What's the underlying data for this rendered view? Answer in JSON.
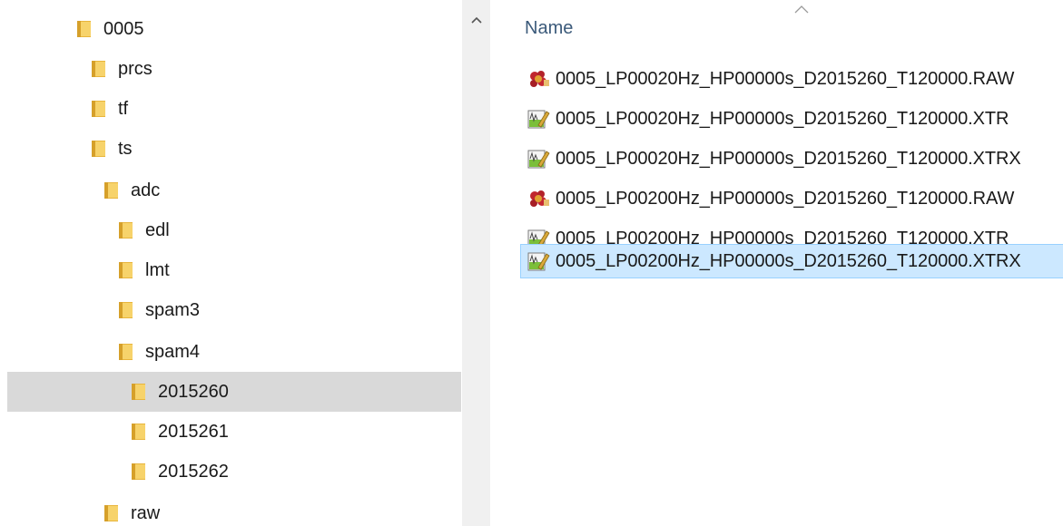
{
  "navigation": {
    "items": [
      {
        "label": "0005",
        "selected": false
      },
      {
        "label": "prcs",
        "selected": false
      },
      {
        "label": "tf",
        "selected": false
      },
      {
        "label": "ts",
        "selected": false
      },
      {
        "label": "adc",
        "selected": false
      },
      {
        "label": "edl",
        "selected": false
      },
      {
        "label": "lmt",
        "selected": false
      },
      {
        "label": "spam3",
        "selected": false
      },
      {
        "label": "spam4",
        "selected": false
      },
      {
        "label": "2015260",
        "selected": true
      },
      {
        "label": "2015261",
        "selected": false
      },
      {
        "label": "2015262",
        "selected": false
      },
      {
        "label": "raw",
        "selected": false
      }
    ]
  },
  "file_list": {
    "column_name": "Name",
    "files": [
      {
        "name": "0005_LP00020Hz_HP00000s_D2015260_T120000.RAW",
        "icon": "raw-file-icon",
        "selected": false
      },
      {
        "name": "0005_LP00020Hz_HP00000s_D2015260_T120000.XTR",
        "icon": "xtr-file-icon",
        "selected": false
      },
      {
        "name": "0005_LP00020Hz_HP00000s_D2015260_T120000.XTRX",
        "icon": "xtr-file-icon",
        "selected": false
      },
      {
        "name": "0005_LP00200Hz_HP00000s_D2015260_T120000.RAW",
        "icon": "raw-file-icon",
        "selected": false
      },
      {
        "name": "0005_LP00200Hz_HP00000s_D2015260_T120000.XTR",
        "icon": "xtr-file-icon",
        "selected": false
      },
      {
        "name": "0005_LP00200Hz_HP00000s_D2015260_T120000.XTRX",
        "icon": "xtr-file-icon",
        "selected": true
      }
    ]
  },
  "colors": {
    "folder": "#e8b53c",
    "folder_light": "#f7d36b",
    "nav_selected": "#d9d9d9",
    "file_selected": "#cce8ff",
    "file_selected_border": "#99d1ff",
    "header_text": "#3b5a7a"
  }
}
